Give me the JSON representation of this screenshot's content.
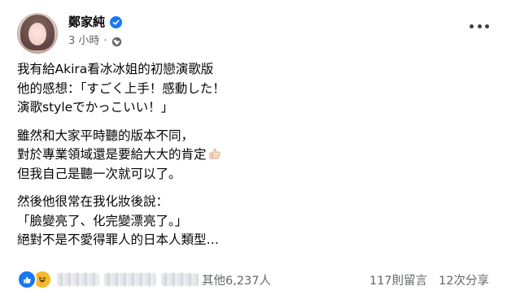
{
  "post": {
    "author": "鄭家純",
    "timestamp": "3 小時",
    "separator": "·",
    "privacy_icon": "globe-icon",
    "verified_icon": "verified-badge-icon",
    "more_icon": "more-options-icon",
    "paragraphs": [
      [
        "我有給Akira看冰冰姐的初戀演歌版",
        "他的感想：「すごく上手！感動した！",
        "演歌styleでかっこいい！」"
      ],
      [
        "雖然和大家平時聽的版本不同，",
        "對於專業領域還是要給大大的肯定",
        "但我自己是聽一次就可以了。"
      ],
      [
        "然後他很常在我化妝後說：",
        "「臉變亮了、化完變漂亮了。」",
        "絕對不是不愛得罪人的日本人類型…"
      ]
    ],
    "emoji_after": "thumbs-up-emoji"
  },
  "footer": {
    "reaction_icons": [
      "like-icon",
      "haha-icon"
    ],
    "reactors_text": "其他6,237人",
    "comments": "117則留言",
    "shares": "12次分享"
  },
  "colors": {
    "verified": "#1877f2",
    "meta_text": "#65676b",
    "like": "#1877f2",
    "haha": "#f7b928"
  }
}
